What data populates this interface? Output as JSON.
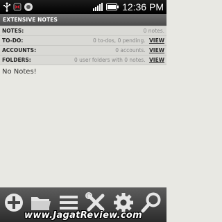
{
  "status_bar": {
    "time": "12:36 PM",
    "icons": [
      "usb-icon",
      "phone-call-icon",
      "notification-icon",
      "signal-icon",
      "battery-icon"
    ]
  },
  "app": {
    "title": "EXTENSIVE NOTES"
  },
  "summary": {
    "rows": [
      {
        "label": "NOTES:",
        "value": "0 notes.",
        "action": ""
      },
      {
        "label": "TO-DO:",
        "value": "0 to-dos, 0 pending.",
        "action": "VIEW"
      },
      {
        "label": "ACCOUNTS:",
        "value": "0 accounts.",
        "action": "VIEW"
      },
      {
        "label": "FOLDERS:",
        "value": "0 user folders with 0 notes.",
        "action": "VIEW"
      }
    ]
  },
  "main": {
    "empty_message": "No Notes!"
  },
  "toolbar": {
    "items": [
      "add-icon",
      "folder-icon",
      "list-icon",
      "tools-icon",
      "settings-gear-icon",
      "search-icon"
    ]
  },
  "watermark": "www.JagatReview.com",
  "colors": {
    "background": "#e8e8e3",
    "summary_background": "#d9d9d5",
    "title_bar": "#5a5a5a",
    "status_bar": "#000000",
    "toolbar_icons": "#e6e6e6"
  }
}
